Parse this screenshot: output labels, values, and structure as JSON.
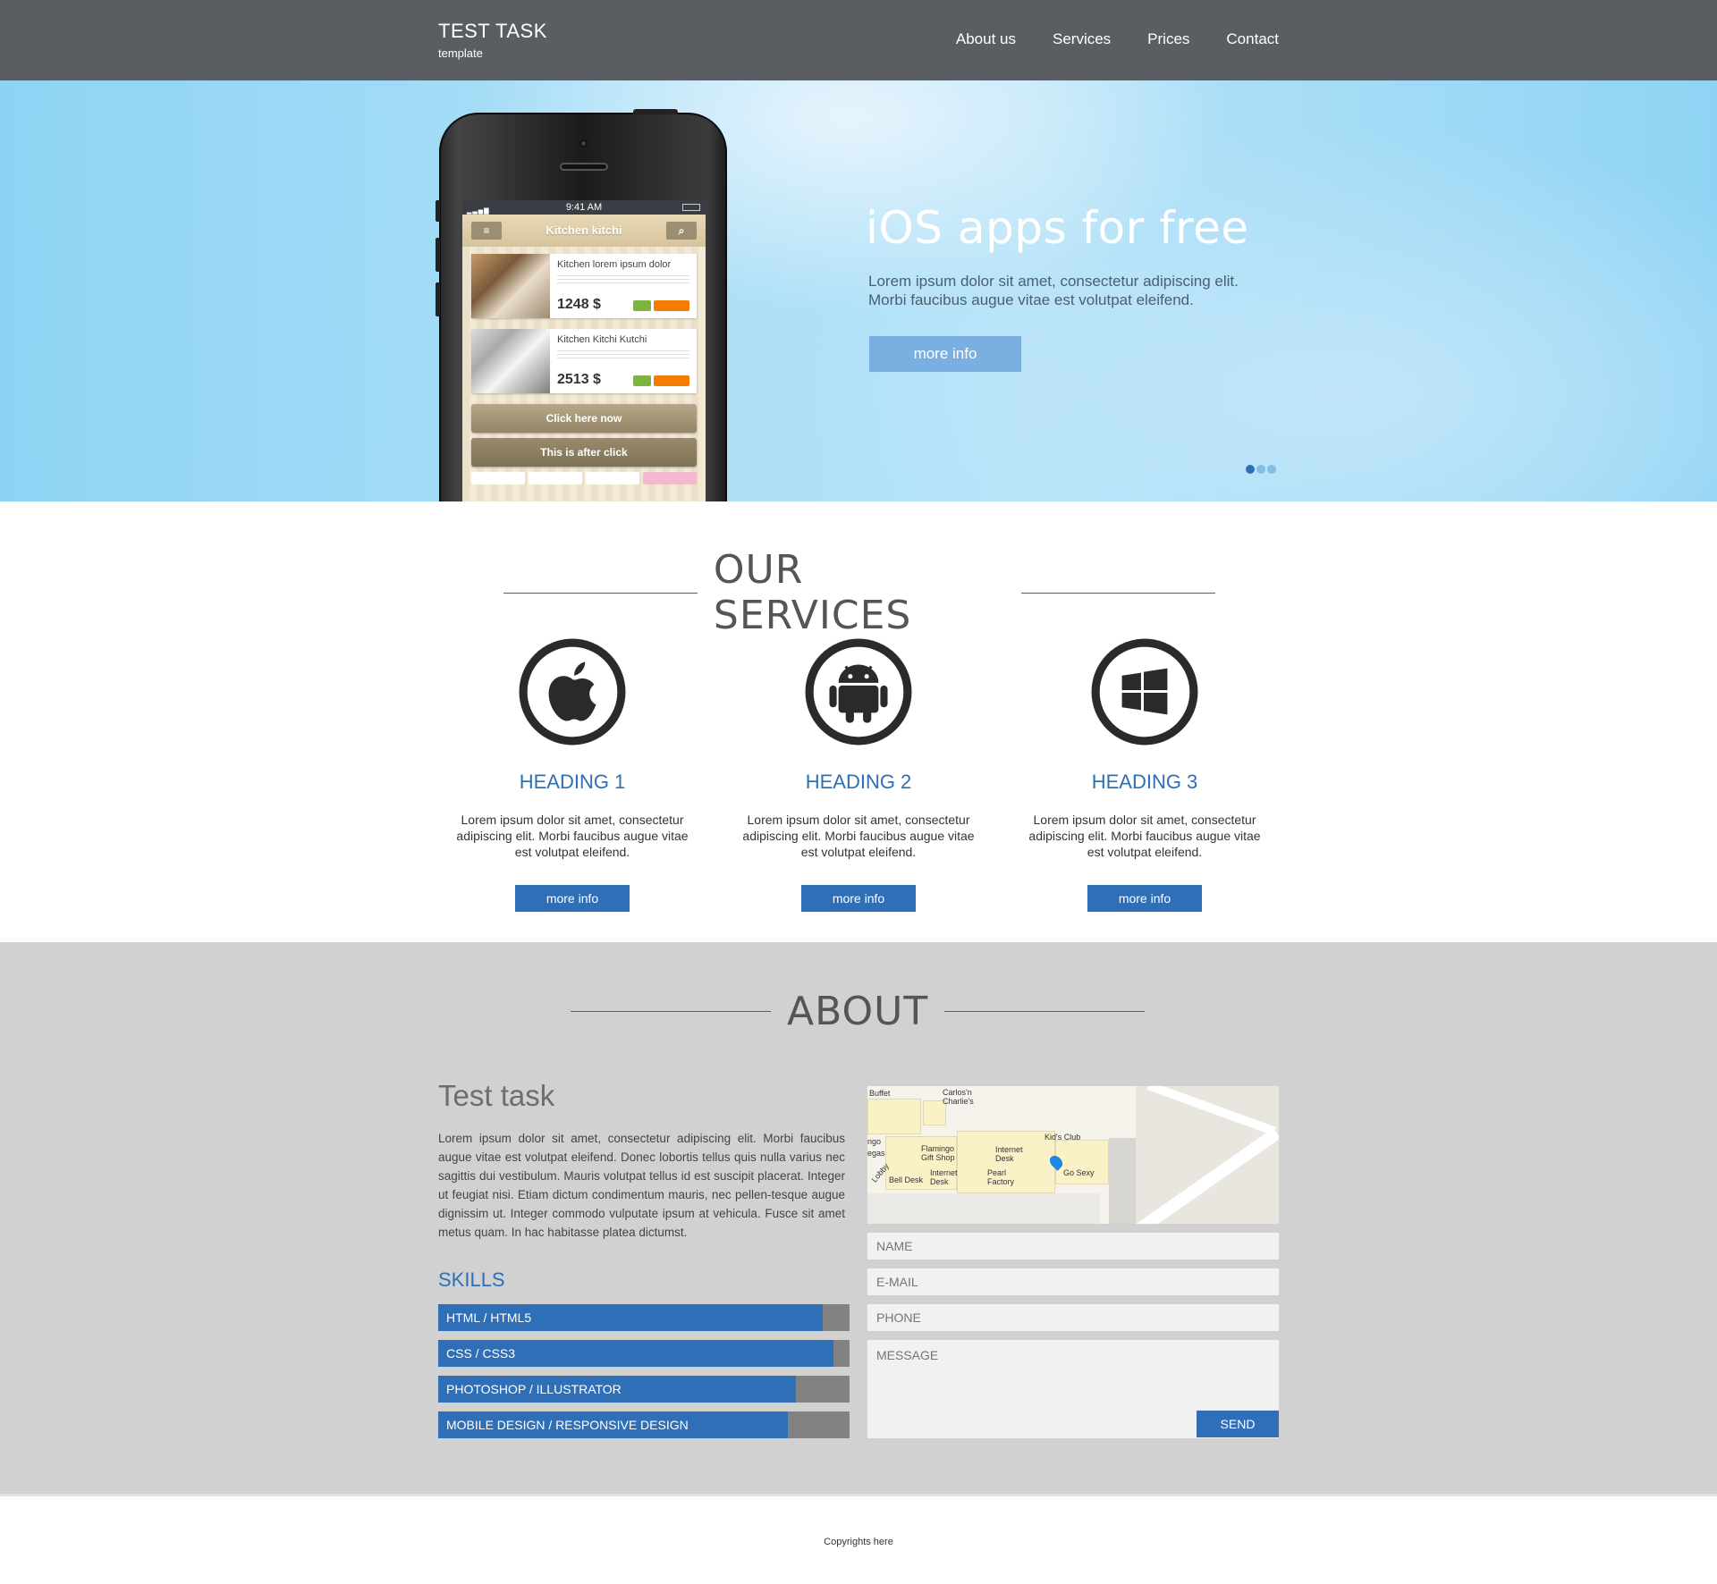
{
  "header": {
    "logo_title": "TEST TASK",
    "logo_sub": "template",
    "nav": [
      "About us",
      "Services",
      "Prices",
      "Contact"
    ]
  },
  "hero": {
    "title": "iOS apps for free",
    "text": "Lorem ipsum dolor sit amet, consectetur adipiscing elit. Morbi faucibus augue vitae est volutpat eleifend.",
    "button": "more info",
    "slides": 3,
    "active_slide": 1,
    "phone": {
      "time": "9:41 AM",
      "app_title": "Kitchen kitchi",
      "items": [
        {
          "title": "Kitchen lorem ipsum dolor",
          "price": "1248 $"
        },
        {
          "title": "Kitchen Kitchi Kutchi",
          "price": "2513 $"
        }
      ],
      "btn_primary": "Click here now",
      "btn_after": "This is after click"
    }
  },
  "services": {
    "title": "OUR SERVICES",
    "items": [
      {
        "icon": "apple-icon",
        "heading": "HEADING 1",
        "text": "Lorem ipsum dolor sit amet, consectetur adipiscing elit. Morbi faucibus augue vitae est volutpat eleifend.",
        "button": "more info"
      },
      {
        "icon": "android-icon",
        "heading": "HEADING 2",
        "text": "Lorem ipsum dolor sit amet, consectetur adipiscing elit. Morbi faucibus augue vitae est volutpat eleifend.",
        "button": "more info"
      },
      {
        "icon": "windows-icon",
        "heading": "HEADING 3",
        "text": "Lorem ipsum dolor sit amet, consectetur adipiscing elit. Morbi faucibus augue vitae est volutpat eleifend.",
        "button": "more info"
      }
    ]
  },
  "about": {
    "title": "ABOUT",
    "subtitle": "Test task",
    "text": "Lorem ipsum dolor sit amet, consectetur adipiscing elit. Morbi faucibus augue vitae est volutpat eleifend. Donec lobortis tellus quis nulla varius nec sagittis dui vestibulum. Mauris volutpat tellus id est suscipit placerat. Integer ut feugiat nisi. Etiam dictum condimentum mauris, nec pellen-tesque augue dignissim ut. Integer commodo vulputate ipsum at vehicula. Fusce sit amet metus quam. In hac habitasse platea dictumst.",
    "skills_title": "SKILLS",
    "skills": [
      {
        "label": "HTML / HTML5",
        "level": 0.935
      },
      {
        "label": "CSS / CSS3",
        "level": 0.96
      },
      {
        "label": "PHOTOSHOP / ILLUSTRATOR",
        "level": 0.87
      },
      {
        "label": "MOBILE DESIGN / RESPONSIVE DESIGN",
        "level": 0.85
      }
    ],
    "map_labels": [
      "Buffet",
      "Carlos'n Charlie's",
      "ngo",
      "egas",
      "Flamingo Gift Shop",
      "Internet Desk",
      "Kid's Club",
      "Lobby",
      "Bell Desk",
      "Internet Desk",
      "Pearl Factory",
      "Go Sexy"
    ],
    "form": {
      "name": "NAME",
      "email": "E-MAIL",
      "phone": "PHONE",
      "message": "MESSAGE",
      "send": "SEND"
    }
  },
  "footer": {
    "copyright": "Copyrights here"
  },
  "colors": {
    "header_bg": "#5a5e63",
    "accent": "#2f6fb7",
    "about_bg": "#d1d1d1",
    "hero_button": "#79b0e1"
  }
}
